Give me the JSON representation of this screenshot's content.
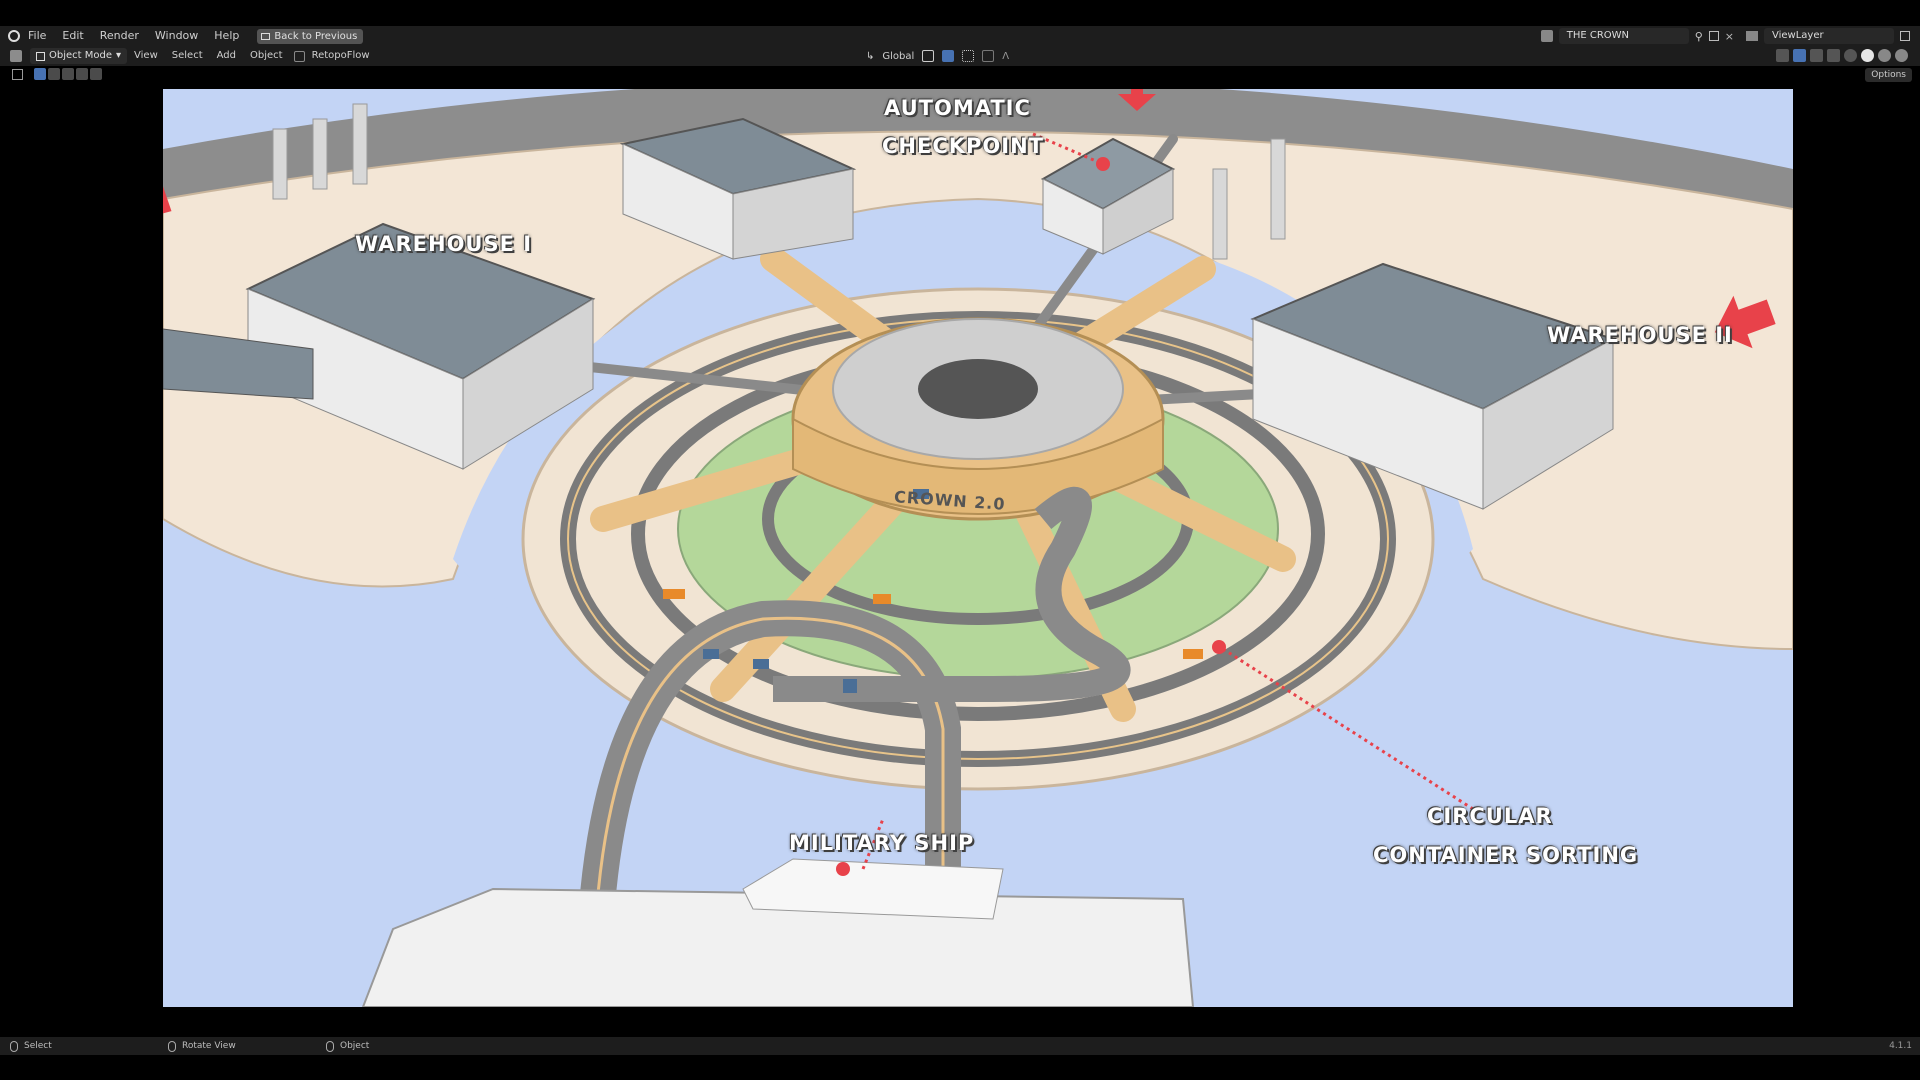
{
  "topbar": {
    "menu": [
      "File",
      "Edit",
      "Render",
      "Window",
      "Help"
    ],
    "back_label": "Back to Previous",
    "scene": "THE CROWN",
    "view_layer": "ViewLayer"
  },
  "header": {
    "mode": "Object Mode",
    "menu": [
      "View",
      "Select",
      "Add",
      "Object"
    ],
    "addon": "RetopoFlow",
    "transform_orientation": "Global",
    "options_label": "Options"
  },
  "labels": {
    "warehouse_1": "WAREHOUSE I",
    "warehouse_2": "WAREHOUSE II",
    "checkpoint_1": "AUTOMATIC",
    "checkpoint_2": "CHECKPOINT",
    "sorting_1": "CIRCULAR",
    "sorting_2": "CONTAINER SORTING",
    "ship": "MILITARY SHIP",
    "crown": "CROWN 2.0"
  },
  "statusbar": {
    "select": "Select",
    "rotate": "Rotate View",
    "object": "Object",
    "version": "4.1.1"
  },
  "colors": {
    "water": "#c3d4f5",
    "road": "#7a7a7a",
    "road_edge": "#e8c48a",
    "platform": "#f3e6d6",
    "roof": "#7f8c96",
    "arrow": "#e8424a",
    "grass": "#b4d79a"
  }
}
